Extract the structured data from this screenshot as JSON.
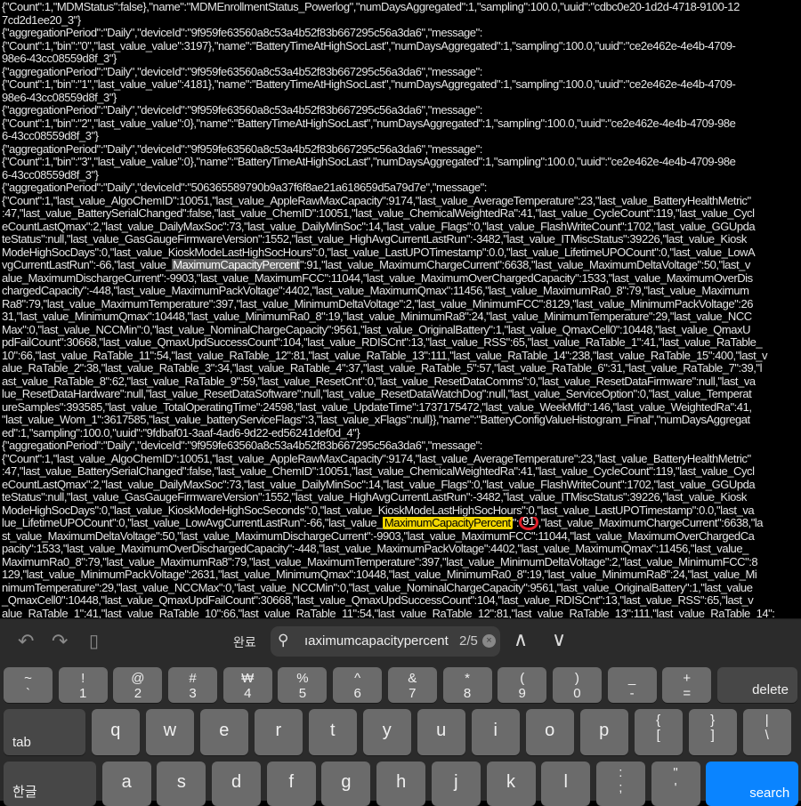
{
  "log": [
    "{\"Count\":1,\"MDMStatus\":false},\"name\":\"MDMEnrollmentStatus_Powerlog\",\"numDaysAggregated\":1,\"sampling\":100.0,\"uuid\":\"cdbc0e20-1d2d-4718-9100-12",
    "7cd2d1ee20_3\"}",
    "{\"aggregationPeriod\":\"Daily\",\"deviceId\":\"9f959fe63560a8c53a4b52f83b667295c56a3da6\",\"message\":",
    "{\"Count\":1,\"bin\":\"0\",\"last_value_value\":3197},\"name\":\"BatteryTimeAtHighSocLast\",\"numDaysAggregated\":1,\"sampling\":100.0,\"uuid\":\"ce2e462e-4e4b-4709-",
    "98e6-43cc08559d8f_3\"}",
    "{\"aggregationPeriod\":\"Daily\",\"deviceId\":\"9f959fe63560a8c53a4b52f83b667295c56a3da6\",\"message\":",
    "{\"Count\":1,\"bin\":\"1\",\"last_value_value\":4181},\"name\":\"BatteryTimeAtHighSocLast\",\"numDaysAggregated\":1,\"sampling\":100.0,\"uuid\":\"ce2e462e-4e4b-4709-",
    "98e6-43cc08559d8f_3\"}",
    "{\"aggregationPeriod\":\"Daily\",\"deviceId\":\"9f959fe63560a8c53a4b52f83b667295c56a3da6\",\"message\":",
    "{\"Count\":1,\"bin\":\"2\",\"last_value_value\":0},\"name\":\"BatteryTimeAtHighSocLast\",\"numDaysAggregated\":1,\"sampling\":100.0,\"uuid\":\"ce2e462e-4e4b-4709-98e",
    "6-43cc08559d8f_3\"}",
    "{\"aggregationPeriod\":\"Daily\",\"deviceId\":\"9f959fe63560a8c53a4b52f83b667295c56a3da6\",\"message\":",
    "{\"Count\":1,\"bin\":\"3\",\"last_value_value\":0},\"name\":\"BatteryTimeAtHighSocLast\",\"numDaysAggregated\":1,\"sampling\":100.0,\"uuid\":\"ce2e462e-4e4b-4709-98e",
    "6-43cc08559d8f_3\"}",
    "{\"aggregationPeriod\":\"Daily\",\"deviceId\":\"506365589790b9a37f6f8ae21a618659d5a79d7e\",\"message\":",
    "{\"Count\":1,\"last_value_AlgoChemID\":10051,\"last_value_AppleRawMaxCapacity\":9174,\"last_value_AverageTemperature\":23,\"last_value_BatteryHealthMetric\"",
    ":47,\"last_value_BatterySerialChanged\":false,\"last_value_ChemID\":10051,\"last_value_ChemicalWeightedRa\":41,\"last_value_CycleCount\":119,\"last_value_Cycl",
    "eCountLastQmax\":2,\"last_value_DailyMaxSoc\":73,\"last_value_DailyMinSoc\":14,\"last_value_Flags\":0,\"last_value_FlashWriteCount\":1702,\"last_value_GGUpda",
    "teStatus\":null,\"last_value_GasGaugeFirmwareVersion\":1552,\"last_value_HighAvgCurrentLastRun\":-3482,\"last_value_ITMiscStatus\":39226,\"last_value_Kiosk",
    "ModeHighSocDays\":0,\"last_value_KioskModeLastHighSocHours\":0,\"last_value_LastUPOTimestamp\":0.0,\"last_value_LifetimeUPOCount\":0,\"last_value_LowA",
    {
      "pre": "vgCurrentLastRun\":-66,\"last_value_",
      "match": "MaximumCapacityPercent",
      "post": "\":91,\"last_value_MaximumChargeCurrent\":6638,\"last_value_MaximumDeltaVoltage\":50,\"last_v"
    },
    "alue_MaximumDischargeCurrent\":-9903,\"last_value_MaximumFCC\":11044,\"last_value_MaximumOverChargedCapacity\":1533,\"last_value_MaximumOverDis",
    "chargedCapacity\":-448,\"last_value_MaximumPackVoltage\":4402,\"last_value_MaximumQmax\":11456,\"last_value_MaximumRa0_8\":79,\"last_value_Maximum",
    "Ra8\":79,\"last_value_MaximumTemperature\":397,\"last_value_MinimumDeltaVoltage\":2,\"last_value_MinimumFCC\":8129,\"last_value_MinimumPackVoltage\":26",
    "31,\"last_value_MinimumQmax\":10448,\"last_value_MinimumRa0_8\":19,\"last_value_MinimumRa8\":24,\"last_value_MinimumTemperature\":29,\"last_value_NCC",
    "Max\":0,\"last_value_NCCMin\":0,\"last_value_NominalChargeCapacity\":9561,\"last_value_OriginalBattery\":1,\"last_value_QmaxCell0\":10448,\"last_value_QmaxU",
    "pdFailCount\":30668,\"last_value_QmaxUpdSuccessCount\":104,\"last_value_RDISCnt\":13,\"last_value_RSS\":65,\"last_value_RaTable_1\":41,\"last_value_RaTable_",
    "10\":66,\"last_value_RaTable_11\":54,\"last_value_RaTable_12\":81,\"last_value_RaTable_13\":111,\"last_value_RaTable_14\":238,\"last_value_RaTable_15\":400,\"last_v",
    "alue_RaTable_2\":38,\"last_value_RaTable_3\":34,\"last_value_RaTable_4\":37,\"last_value_RaTable_5\":57,\"last_value_RaTable_6\":31,\"last_value_RaTable_7\":39,\"l",
    "ast_value_RaTable_8\":62,\"last_value_RaTable_9\":59,\"last_value_ResetCnt\":0,\"last_value_ResetDataComms\":0,\"last_value_ResetDataFirmware\":null,\"last_va",
    "lue_ResetDataHardware\":null,\"last_value_ResetDataSoftware\":null,\"last_value_ResetDataWatchDog\":null,\"last_value_ServiceOption\":0,\"last_value_Temperat",
    "ureSamples\":393585,\"last_value_TotalOperatingTime\":24598,\"last_value_UpdateTime\":1737175472,\"last_value_WeekMfd\":146,\"last_value_WeightedRa\":41,",
    "\"last_value_Wom_1\":3617585,\"last_value_batteryServiceFlags\":3,\"last_value_xFlags\":null}},\"name\":\"BatteryConfigValueHistogram_Final\",\"numDaysAggregat",
    "ed\":1,\"sampling\":100.0,\"uuid\":\"9fdbaf01-3aaf-4ad6-9d22-ed56241def0d_4\"}",
    "{\"aggregationPeriod\":\"Daily\",\"deviceId\":\"9f959fe63560a8c53a4b52f83b667295c56a3da6\",\"message\":",
    "{\"Count\":1,\"last_value_AlgoChemID\":10051,\"last_value_AppleRawMaxCapacity\":9174,\"last_value_AverageTemperature\":23,\"last_value_BatteryHealthMetric\"",
    ":47,\"last_value_BatterySerialChanged\":false,\"last_value_ChemID\":10051,\"last_value_ChemicalWeightedRa\":41,\"last_value_CycleCount\":119,\"last_value_Cycl",
    "eCountLastQmax\":2,\"last_value_DailyMaxSoc\":73,\"last_value_DailyMinSoc\":14,\"last_value_Flags\":0,\"last_value_FlashWriteCount\":1702,\"last_value_GGUpda",
    "teStatus\":null,\"last_value_GasGaugeFirmwareVersion\":1552,\"last_value_HighAvgCurrentLastRun\":-3482,\"last_value_ITMiscStatus\":39226,\"last_value_Kiosk",
    "ModeHighSocDays\":0,\"last_value_KioskModeHighSocSeconds\":0,\"last_value_KioskModeLastHighSocHours\":0,\"last_value_LastUPOTimestamp\":0.0,\"last_va",
    {
      "pre": "lue_LifetimeUPOCount\":0,\"last_value_LowAvgCurrentLastRun\":-66,\"last_value_",
      "match": "MaximumCapacityPercent",
      "mid": "\":",
      "circled": "91",
      "post": ",\"last_value_MaximumChargeCurrent\":6638,\"la",
      "current": true
    },
    "st_value_MaximumDeltaVoltage\":50,\"last_value_MaximumDischargeCurrent\":-9903,\"last_value_MaximumFCC\":11044,\"last_value_MaximumOverChargedCa",
    "pacity\":1533,\"last_value_MaximumOverDischargedCapacity\":-448,\"last_value_MaximumPackVoltage\":4402,\"last_value_MaximumQmax\":11456,\"last_value_",
    "MaximumRa0_8\":79,\"last_value_MaximumRa8\":79,\"last_value_MaximumTemperature\":397,\"last_value_MinimumDeltaVoltage\":2,\"last_value_MinimumFCC\":8",
    "129,\"last_value_MinimumPackVoltage\":2631,\"last_value_MinimumQmax\":10448,\"last_value_MinimumRa0_8\":19,\"last_value_MinimumRa8\":24,\"last_value_Mi",
    "nimumTemperature\":29,\"last_value_NCCMax\":0,\"last_value_NCCMin\":0,\"last_value_NominalChargeCapacity\":9561,\"last_value_OriginalBattery\":1,\"last_value",
    "_QmaxCell0\":10448,\"last_value_QmaxUpdFailCount\":30668,\"last_value_QmaxUpdSuccessCount\":104,\"last_value_RDISCnt\":13,\"last_value_RSS\":65,\"last_v",
    "alue_RaTable_1\":41,\"last_value_RaTable_10\":66,\"last_value_RaTable_11\":54,\"last_value_RaTable_12\":81,\"last_value_RaTable_13\":111,\"last_value_RaTable_14\":"
  ],
  "toolbar": {
    "undo_icon": "undo-icon",
    "redo_icon": "redo-icon",
    "paste_icon": "clipboard-icon",
    "done_label": "완료",
    "search_query": "ıaximumcapacitypercent",
    "match_count": "2/5",
    "clear_icon": "×",
    "prev_icon": "∧",
    "next_icon": "∨"
  },
  "keyboard": {
    "row1": [
      [
        "~",
        "`"
      ],
      [
        "!",
        "1"
      ],
      [
        "@",
        "2"
      ],
      [
        "#",
        "3"
      ],
      [
        "₩",
        "4"
      ],
      [
        "%",
        "5"
      ],
      [
        "^",
        "6"
      ],
      [
        "&",
        "7"
      ],
      [
        "*",
        "8"
      ],
      [
        "(",
        "9"
      ],
      [
        ")",
        "0"
      ],
      [
        "_",
        "-"
      ],
      [
        "+",
        "="
      ]
    ],
    "delete": "delete",
    "tab": "tab",
    "row2": [
      [
        "",
        "q"
      ],
      [
        "",
        "w"
      ],
      [
        "",
        "e"
      ],
      [
        "",
        "r"
      ],
      [
        "",
        "t"
      ],
      [
        "",
        "y"
      ],
      [
        "",
        "u"
      ],
      [
        "",
        "i"
      ],
      [
        "",
        "o"
      ],
      [
        "",
        "p"
      ],
      [
        "{",
        "["
      ],
      [
        "}",
        "]"
      ],
      [
        "|",
        "\\"
      ]
    ],
    "hangul": "한글",
    "row3": [
      [
        "",
        "a"
      ],
      [
        "",
        "s"
      ],
      [
        "",
        "d"
      ],
      [
        "",
        "f"
      ],
      [
        "",
        "g"
      ],
      [
        "",
        "h"
      ],
      [
        "",
        "j"
      ],
      [
        "",
        "k"
      ],
      [
        "",
        "l"
      ],
      [
        ":",
        ";"
      ],
      [
        "\"",
        "'"
      ]
    ],
    "search": "search"
  },
  "colors": {
    "current_match": "#f2d600",
    "other_match": "#5a5a5a",
    "ring": "#e0202a",
    "search_key": "#0a84ff"
  }
}
